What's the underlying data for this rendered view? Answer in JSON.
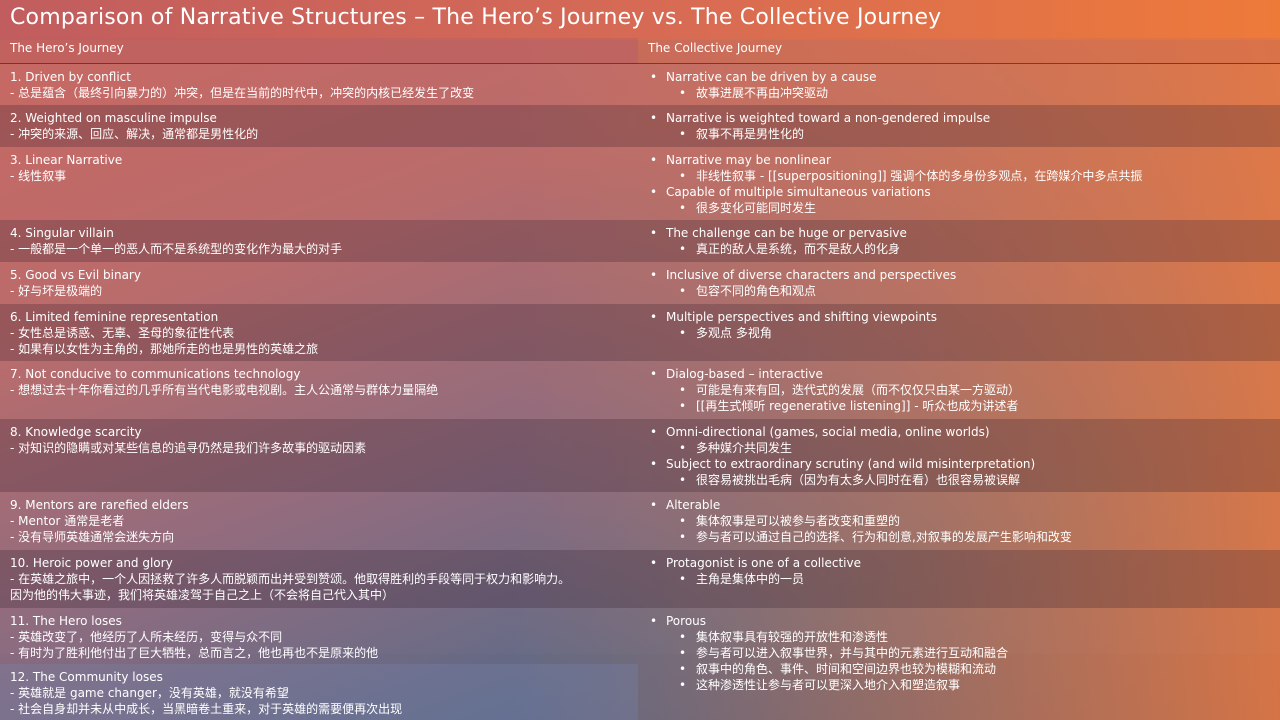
{
  "title": "Comparison of Narrative Structures – The Hero’s Journey vs. The Collective Journey",
  "headers": {
    "left": "The Hero’s Journey",
    "right": "The Collective Journey"
  },
  "rows": [
    {
      "left": [
        "1.  Driven by conflict",
        "- 总是蕴含（最终引向暴力的）冲突，但是在当前的时代中，冲突的内核已经发生了改变"
      ],
      "right": [
        {
          "t": "Narrative can be driven by a cause",
          "sub": [
            "故事进展不再由冲突驱动"
          ]
        }
      ]
    },
    {
      "left": [
        "2. Weighted on masculine impulse",
        "- 冲突的来源、回应、解决，通常都是男性化的"
      ],
      "right": [
        {
          "t": "Narrative is weighted toward a non-gendered impulse",
          "sub": [
            "叙事不再是男性化的"
          ]
        }
      ]
    },
    {
      "left": [
        "3. Linear Narrative",
        "- 线性叙事"
      ],
      "right": [
        {
          "t": "Narrative may be nonlinear",
          "sub": [
            "非线性叙事 - [[superpositioning]] 强调个体的多身份多观点，在跨媒介中多点共振"
          ]
        },
        {
          "t": "Capable of multiple simultaneous variations",
          "sub": [
            "很多变化可能同时发生"
          ]
        }
      ]
    },
    {
      "left": [
        "4. Singular villain",
        "- 一般都是一个单一的恶人而不是系统型的变化作为最大的对手"
      ],
      "right": [
        {
          "t": "The challenge can be huge or pervasive",
          "sub": [
            "真正的敌人是系统，而不是敌人的化身"
          ]
        }
      ]
    },
    {
      "left": [
        "5. Good vs Evil binary",
        "- 好与坏是极端的"
      ],
      "right": [
        {
          "t": "Inclusive of diverse characters and perspectives",
          "sub": [
            "包容不同的角色和观点"
          ]
        }
      ]
    },
    {
      "left": [
        "6. Limited feminine representation",
        "- 女性总是诱惑、无辜、圣母的象征性代表",
        "- 如果有以女性为主角的，那她所走的也是男性的英雄之旅"
      ],
      "right": [
        {
          "t": "Multiple perspectives and shifting viewpoints",
          "sub": [
            "多观点 多视角"
          ]
        }
      ]
    },
    {
      "left": [
        "7. Not conducive to communications technology",
        "- 想想过去十年你看过的几乎所有当代电影或电视剧。主人公通常与群体力量隔绝"
      ],
      "right": [
        {
          "t": "Dialog-based  – interactive",
          "sub": [
            "可能是有来有回，迭代式的发展（而不仅仅只由某一方驱动）",
            "[[再生式倾听 regenerative listening]] - 听众也成为讲述者"
          ]
        }
      ]
    },
    {
      "left": [
        "8. Knowledge scarcity",
        "- 对知识的隐瞒或对某些信息的追寻仍然是我们许多故事的驱动因素"
      ],
      "right": [
        {
          "t": "Omni-directional (games, social media, online worlds)",
          "sub": [
            "多种媒介共同发生"
          ]
        },
        {
          "t": "Subject to extraordinary scrutiny (and wild misinterpretation)",
          "sub": [
            "很容易被挑出毛病（因为有太多人同时在看）也很容易被误解"
          ]
        }
      ]
    },
    {
      "left": [
        "9. Mentors are rarefied elders",
        "- Mentor 通常是老者",
        "- 没有导师英雄通常会迷失方向"
      ],
      "right": [
        {
          "t": "Alterable",
          "sub": [
            "集体叙事是可以被参与者改变和重塑的",
            "参与者可以通过自己的选择、行为和创意,对叙事的发展产生影响和改变"
          ]
        }
      ]
    },
    {
      "left": [
        "10. Heroic power and glory",
        "- 在英雄之旅中，一个人因拯救了许多人而脱颖而出并受到赞颂。他取得胜利的手段等同于权力和影响力。",
        "因为他的伟大事迹，我们将英雄凌驾于自己之上（不会将自己代入其中）"
      ],
      "right": [
        {
          "t": "Protagonist is one of a collective",
          "sub": [
            "主角是集体中的一员"
          ]
        }
      ]
    },
    {
      "left": [
        "11. The Hero loses",
        "- 英雄改变了，他经历了人所未经历，变得与众不同",
        "- 有时为了胜利他付出了巨大牺牲，总而言之，他也再也不是原来的他"
      ],
      "right": [
        {
          "t": "Porous",
          "sub": [
            "集体叙事具有较强的开放性和渗透性",
            "参与者可以进入叙事世界，并与其中的元素进行互动和融合",
            "叙事中的角色、事件、时间和空间边界也较为模糊和流动",
            "这种渗透性让参与者可以更深入地介入和塑造叙事"
          ]
        }
      ]
    }
  ],
  "row12": [
    "12. The Community loses",
    "- 英雄就是 game changer，没有英雄，就没有希望",
    "- 社会自身却并未从中成长，当黑暗卷土重来，对于英雄的需要便再次出现"
  ],
  "colors": {
    "warm": "#ee7a3a",
    "cool": "#4d5d82",
    "rose": "#c15d5f"
  }
}
